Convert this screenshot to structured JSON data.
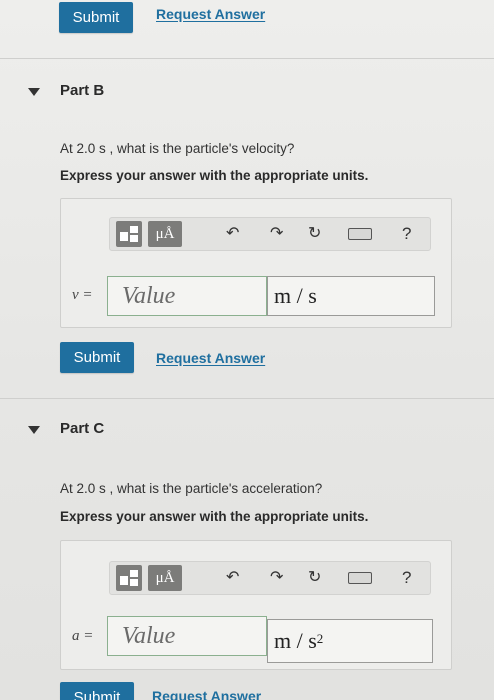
{
  "top": {
    "submit_label": "Submit",
    "request_label": "Request Answer"
  },
  "part_b": {
    "title": "Part B",
    "question": "At 2.0 s , what is the particle's velocity?",
    "instruction": "Express your answer with the appropriate units.",
    "toolbar": {
      "mu_label": "μÅ",
      "help_label": "?"
    },
    "variable_label": "v =",
    "value_placeholder": "Value",
    "units_value": "m / s",
    "submit_label": "Submit",
    "request_label": "Request Answer"
  },
  "part_c": {
    "title": "Part C",
    "question": "At 2.0 s , what is the particle's acceleration?",
    "instruction": "Express your answer with the appropriate units.",
    "toolbar": {
      "mu_label": "μÅ",
      "help_label": "?"
    },
    "variable_label": "a =",
    "value_placeholder": "Value",
    "units_value": "m / s",
    "units_exponent": "2",
    "submit_label": "Submit",
    "request_label": "Request Answer"
  },
  "colors": {
    "accent": "#1f6f9f",
    "input_border": "#8bb08f",
    "toolbar_button": "#7c7c7a"
  },
  "icons": [
    "caret-down-icon",
    "templates-icon",
    "undo-icon",
    "redo-icon",
    "reset-icon",
    "keyboard-icon",
    "help-icon"
  ]
}
